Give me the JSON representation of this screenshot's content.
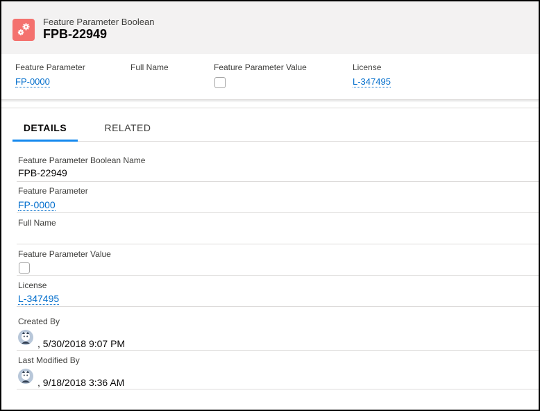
{
  "header": {
    "object_label": "Feature Parameter Boolean",
    "record_title": "FPB-22949",
    "icon": "gears-icon",
    "icon_color": "#f4716e"
  },
  "highlights": {
    "feature_parameter": {
      "label": "Feature Parameter",
      "value": "FP-0000"
    },
    "full_name": {
      "label": "Full Name",
      "value": ""
    },
    "feature_parameter_value": {
      "label": "Feature Parameter Value",
      "checked": false
    },
    "license": {
      "label": "License",
      "value": "L-347495"
    }
  },
  "tabs": [
    {
      "label": "DETAILS",
      "active": true
    },
    {
      "label": "RELATED",
      "active": false
    }
  ],
  "details": {
    "name": {
      "label": "Feature Parameter Boolean Name",
      "value": "FPB-22949"
    },
    "feature_parameter": {
      "label": "Feature Parameter",
      "value": "FP-0000"
    },
    "full_name": {
      "label": "Full Name",
      "value": ""
    },
    "feature_parameter_value": {
      "label": "Feature Parameter Value",
      "checked": false
    },
    "license": {
      "label": "License",
      "value": "L-347495"
    },
    "created_by": {
      "label": "Created By",
      "value": ", 5/30/2018 9:07 PM",
      "avatar": "user-avatar-icon"
    },
    "last_modified_by": {
      "label": "Last Modified By",
      "value": ", 9/18/2018 3:36 AM",
      "avatar": "user-avatar-icon"
    }
  },
  "colors": {
    "link": "#006dcc",
    "tab_active_underline": "#1589ee",
    "header_bg": "#f3f2f2"
  }
}
